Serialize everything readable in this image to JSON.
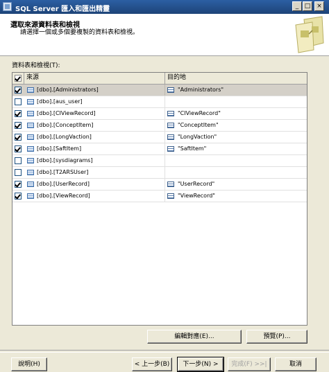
{
  "window": {
    "title": "SQL Server 匯入和匯出精靈",
    "min": "_",
    "max": "□",
    "close": "×"
  },
  "header": {
    "title": "選取來源資料表和檢視",
    "subtitle": "請選擇一個或多個要複製的資料表和檢視。"
  },
  "grid": {
    "label": "資料表和檢視(T):",
    "col_source": "來源",
    "col_dest": "目的地",
    "rows": [
      {
        "source": "[dbo].[Administrators]",
        "dest": "\"Administrators\"",
        "checked": true,
        "selected": true
      },
      {
        "source": "[dbo].[aus_user]",
        "dest": "",
        "checked": false,
        "selected": false
      },
      {
        "source": "[dbo].[CIViewRecord]",
        "dest": "\"CIViewRecord\"",
        "checked": true,
        "selected": false
      },
      {
        "source": "[dbo].[ConceptItem]",
        "dest": "\"ConceptItem\"",
        "checked": true,
        "selected": false
      },
      {
        "source": "[dbo].[LongVaction]",
        "dest": "\"LongVaction\"",
        "checked": true,
        "selected": false
      },
      {
        "source": "[dbo].[SaftItem]",
        "dest": "\"SaftItem\"",
        "checked": true,
        "selected": false
      },
      {
        "source": "[dbo].[sysdiagrams]",
        "dest": "",
        "checked": false,
        "selected": false
      },
      {
        "source": "[dbo].[T2ARSUser]",
        "dest": "",
        "checked": false,
        "selected": false
      },
      {
        "source": "[dbo].[UserRecord]",
        "dest": "\"UserRecord\"",
        "checked": true,
        "selected": false
      },
      {
        "source": "[dbo].[ViewRecord]",
        "dest": "\"ViewRecord\"",
        "checked": true,
        "selected": false
      }
    ]
  },
  "buttons": {
    "edit_mappings": "編輯對應(E)...",
    "preview": "預覽(P)...",
    "help": "說明(H)",
    "back": "< 上一步(B)",
    "next": "下一步(N) >",
    "finish": "完成(F) >>|",
    "cancel": "取消"
  }
}
